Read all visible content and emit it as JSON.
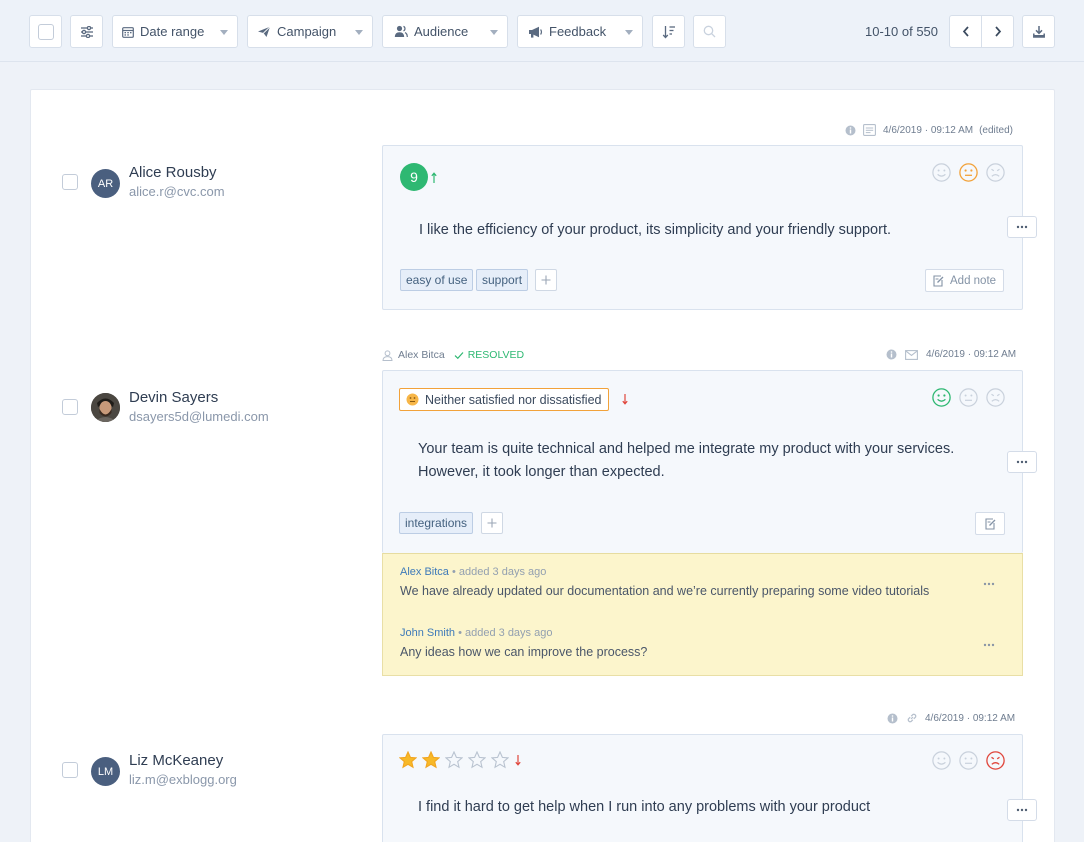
{
  "toolbar": {
    "date_range": "Date range",
    "campaign": "Campaign",
    "audience": "Audience",
    "feedback": "Feedback",
    "pagination": "10-10 of 550"
  },
  "colors": {
    "accent": "#2eb872",
    "neutral": "#f2a23a",
    "negative": "#e0473d",
    "link": "#3e7ab9",
    "note_bg": "#fcf5cc"
  },
  "items": [
    {
      "user": {
        "initials": "AR",
        "name": "Alice Rousby",
        "email": "alice.r@cvc.com"
      },
      "meta": {
        "timestamp": "4/6/2019 · 09:12 AM",
        "edited": "(edited)"
      },
      "score": "9",
      "text": "I like the efficiency of your product, its simplicity and your friendly support.",
      "tags": [
        "easy of use",
        "support"
      ],
      "add_note": "Add note",
      "selected_face": "neutral"
    },
    {
      "user": {
        "name": "Devin Sayers",
        "email": "dsayers5d@lumedi.com"
      },
      "assignee": "Alex Bitca",
      "status": "RESOLVED",
      "meta": {
        "timestamp": "4/6/2019 · 09:12 AM"
      },
      "rating_label": "Neither satisfied nor dissatisfied",
      "text_lines": [
        "Your team is quite technical and helped me integrate my product with your services.",
        "However, it took longer than expected."
      ],
      "tags": [
        "integrations"
      ],
      "selected_face": "happy",
      "notes": [
        {
          "author": "Alex Bitca",
          "ago": "• added 3 days ago",
          "text": "We have already updated our documentation and we’re currently preparing some video tutorials"
        },
        {
          "author": "John Smith",
          "ago": "• added 3 days ago",
          "text": "Any ideas how we can improve the process?"
        }
      ]
    },
    {
      "user": {
        "initials": "LM",
        "name": "Liz McKeaney",
        "email": "liz.m@exblogg.org"
      },
      "meta": {
        "timestamp": "4/6/2019 · 09:12 AM"
      },
      "stars": 2,
      "stars_max": 5,
      "text": "I find it hard to get help when I run into any problems with your product",
      "selected_face": "sad"
    }
  ]
}
